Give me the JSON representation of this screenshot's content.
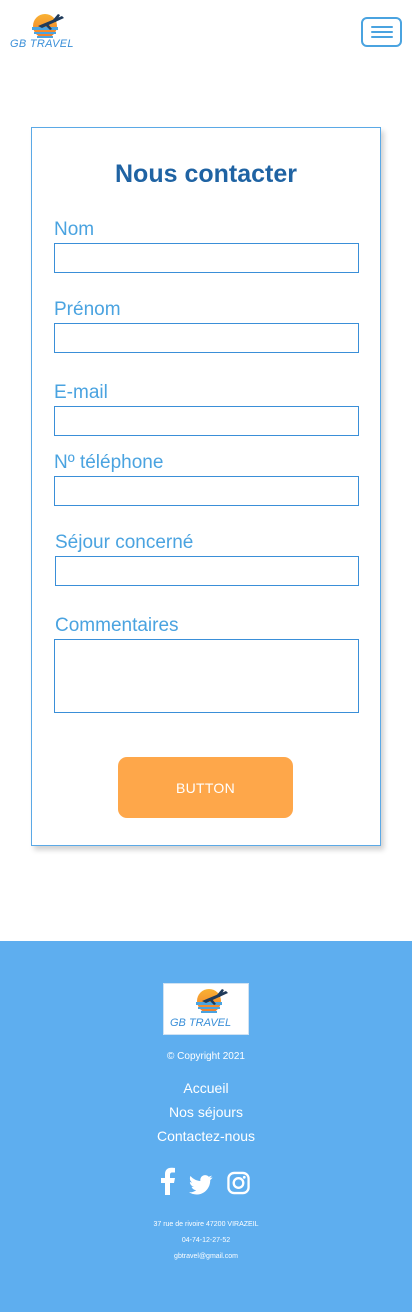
{
  "header": {
    "logo_text": "GB TRAVEL",
    "menu_icon": "hamburger-icon"
  },
  "form": {
    "title": "Nous contacter",
    "fields": [
      {
        "label": "Nom",
        "value": ""
      },
      {
        "label": "Prénom",
        "value": ""
      },
      {
        "label": "E-mail",
        "value": ""
      },
      {
        "label": "Nº téléphone",
        "value": ""
      },
      {
        "label": "Séjour concerné",
        "value": ""
      },
      {
        "label": "Commentaires",
        "value": ""
      }
    ],
    "submit_label": "BUTTON"
  },
  "footer": {
    "logo_text": "GB TRAVEL",
    "copyright": "© Copyright 2021",
    "links": [
      "Accueil",
      "Nos séjours",
      "Contactez-nous"
    ],
    "socials": [
      "facebook-icon",
      "twitter-icon",
      "instagram-icon"
    ],
    "address": "37 rue de rivoire 47200 VIRAZEIL",
    "phone": "04-74-12-27-52",
    "email": "gbtravel@gmail.com"
  },
  "colors": {
    "primary_blue": "#4aa3e0",
    "title_blue": "#1f63a3",
    "button_orange": "#fea74a",
    "footer_blue": "#5eaeef"
  }
}
